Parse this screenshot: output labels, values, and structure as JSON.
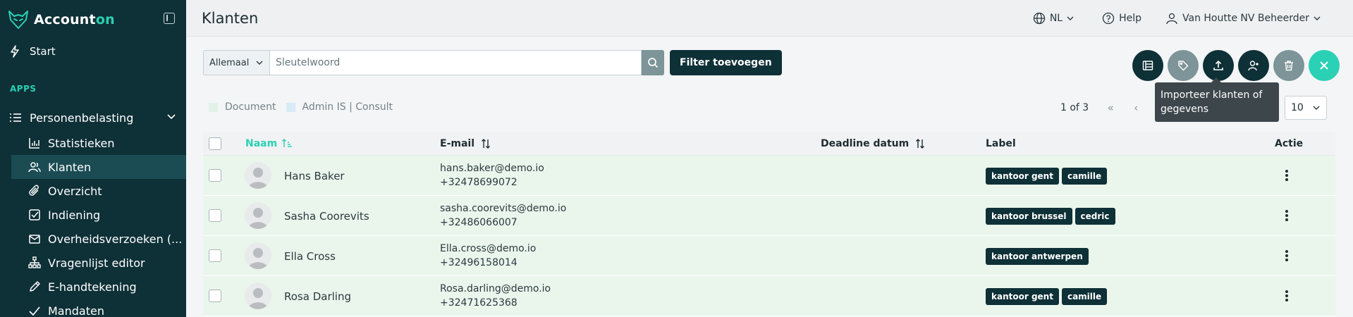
{
  "brand": {
    "name_part1": "Account",
    "name_part2": "on"
  },
  "sidebar": {
    "start_label": "Start",
    "apps_label": "APPS",
    "group_label": "Personenbelasting",
    "items": [
      {
        "label": "Statistieken",
        "icon": "bar-chart-icon"
      },
      {
        "label": "Klanten",
        "icon": "users-icon",
        "active": true
      },
      {
        "label": "Overzicht",
        "icon": "paperclip-icon"
      },
      {
        "label": "Indiening",
        "icon": "check-square-icon"
      },
      {
        "label": "Overheidsverzoeken (...",
        "icon": "mail-icon"
      },
      {
        "label": "Vragenlijst editor",
        "icon": "sitemap-icon"
      },
      {
        "label": "E-handtekening",
        "icon": "pen-icon"
      },
      {
        "label": "Mandaten",
        "icon": "check-icon"
      }
    ]
  },
  "header": {
    "title": "Klanten",
    "language": "NL",
    "help": "Help",
    "user": "Van Houtte NV Beheerder"
  },
  "search": {
    "scope": "Allemaal",
    "placeholder": "Sleutelwoord",
    "filter_button": "Filter toevoegen"
  },
  "tooltip": {
    "line1": "Importeer klanten of",
    "line2": "gegevens"
  },
  "legend": {
    "document": "Document",
    "admin": "Admin IS | Consult"
  },
  "pager": {
    "info": "1 of 3",
    "first": "«",
    "prev": "‹",
    "page_size": "10"
  },
  "table": {
    "headers": {
      "name": "Naam",
      "email": "E-mail",
      "deadline": "Deadline datum",
      "label": "Label",
      "action": "Actie"
    },
    "rows": [
      {
        "name": "Hans Baker",
        "email": "hans.baker@demo.io",
        "phone": "+32478699072",
        "deadline": "",
        "labels": [
          "kantoor gent",
          "camille"
        ]
      },
      {
        "name": "Sasha Coorevits",
        "email": "sasha.coorevits@demo.io",
        "phone": "+32486066007",
        "deadline": "",
        "labels": [
          "kantoor brussel",
          "cedric"
        ]
      },
      {
        "name": "Ella Cross",
        "email": "Ella.cross@demo.io",
        "phone": "+32496158014",
        "deadline": "",
        "labels": [
          "kantoor antwerpen"
        ]
      },
      {
        "name": "Rosa Darling",
        "email": "Rosa.darling@demo.io",
        "phone": "+32471625368",
        "deadline": "",
        "labels": [
          "kantoor gent",
          "camille"
        ]
      }
    ]
  },
  "colors": {
    "sidebar": "#0e3037",
    "accent": "#2ad1b4",
    "row_document": "#eaf6ec"
  }
}
